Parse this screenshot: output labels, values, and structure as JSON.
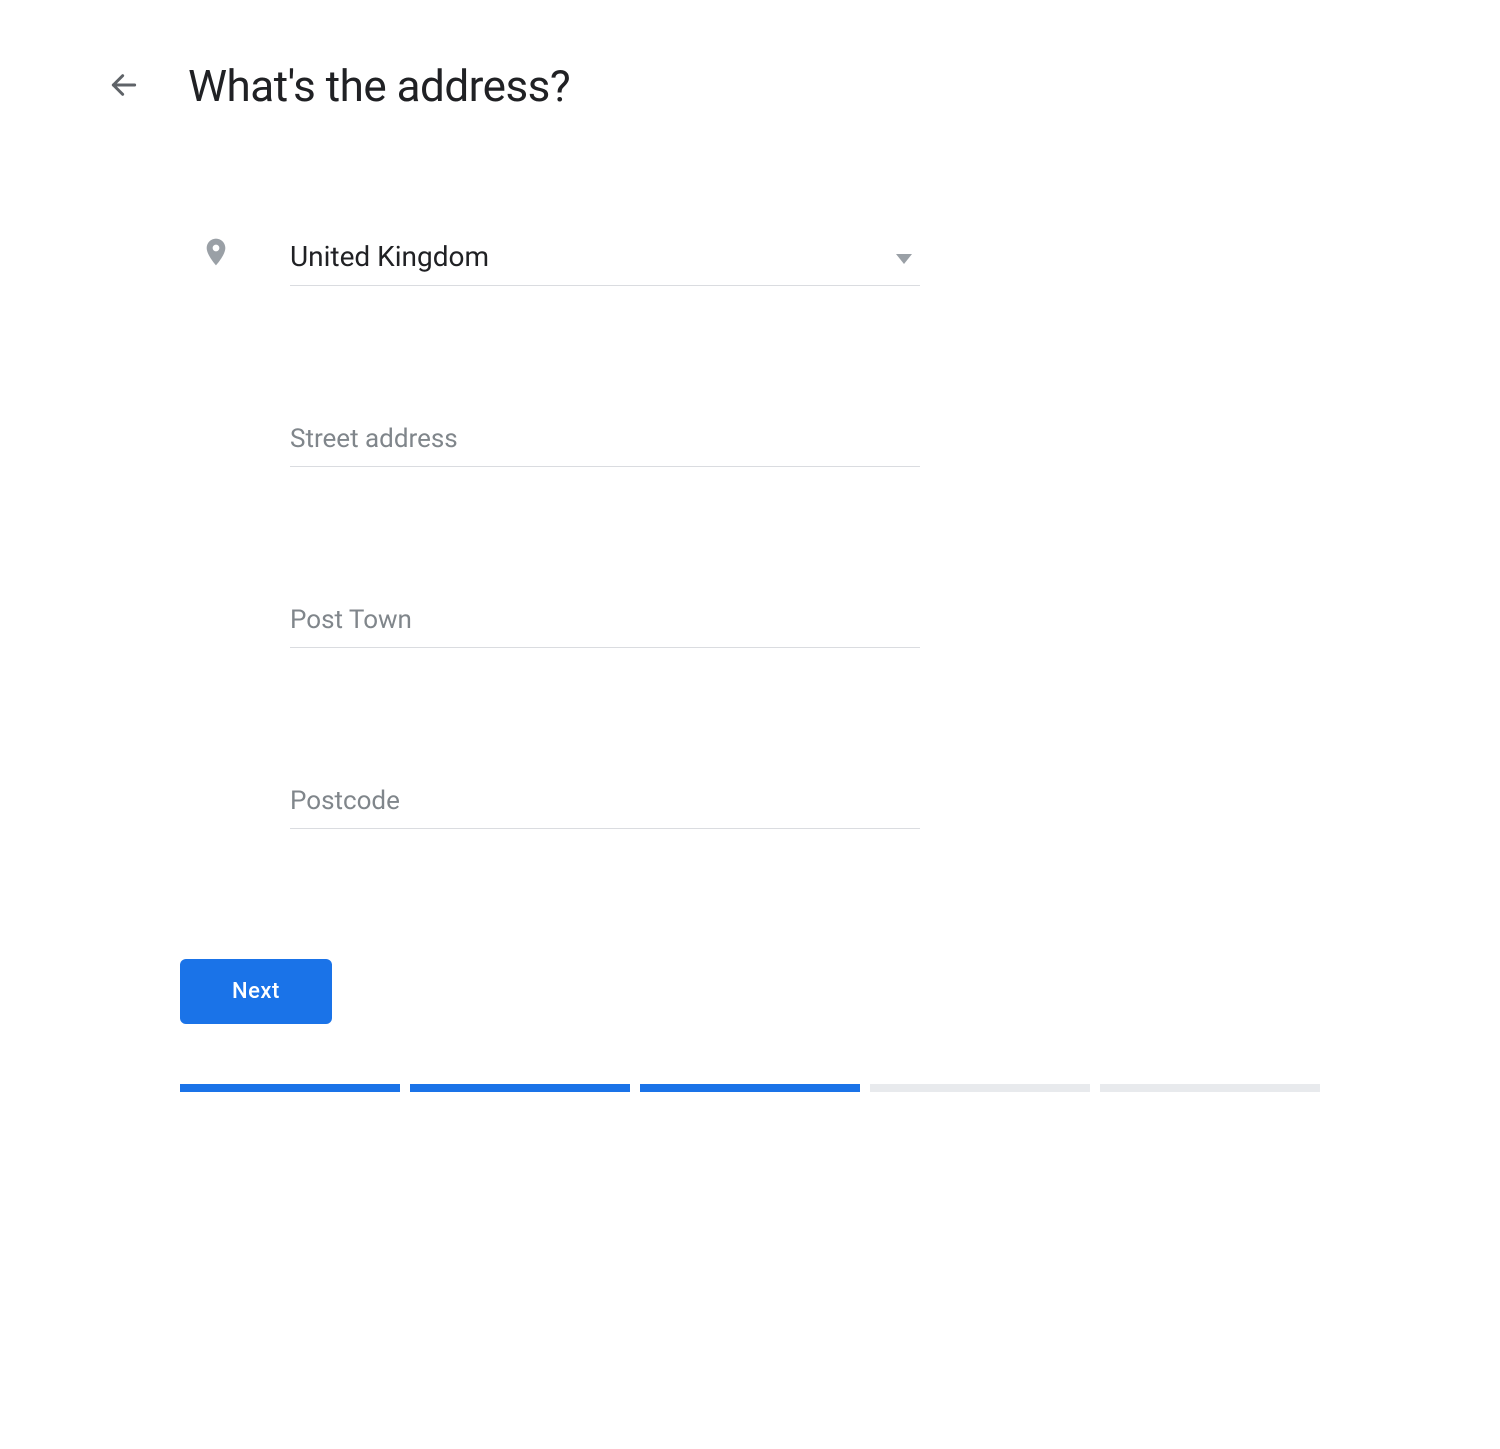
{
  "header": {
    "title": "What's the address?"
  },
  "form": {
    "country": {
      "value": "United Kingdom"
    },
    "street": {
      "placeholder": "Street address",
      "value": ""
    },
    "town": {
      "placeholder": "Post Town",
      "value": ""
    },
    "postcode": {
      "placeholder": "Postcode",
      "value": ""
    }
  },
  "actions": {
    "next_label": "Next"
  },
  "progress": {
    "total": 5,
    "completed": 3
  }
}
